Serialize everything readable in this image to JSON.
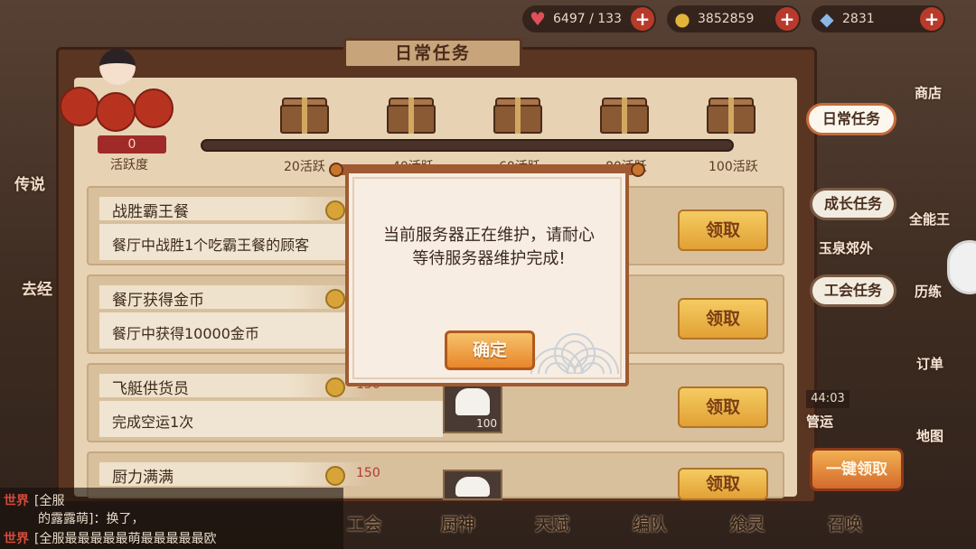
{
  "resources": [
    {
      "icon": "heart-icon",
      "glyph": "♥",
      "color": "#e0505a",
      "value": "6497 / 133"
    },
    {
      "icon": "gold-coin-icon",
      "glyph": "●",
      "color": "#e2b43a",
      "value": "3852859"
    },
    {
      "icon": "crystal-icon",
      "glyph": "◆",
      "color": "#8ab8e8",
      "value": "2831"
    }
  ],
  "panel": {
    "title": "日常任务"
  },
  "activity": {
    "value": "0",
    "label": "活跃度",
    "progress": 0,
    "milestones": [
      "20活跃",
      "40活跃",
      "60活跃",
      "80活跃",
      "100活跃"
    ]
  },
  "tasks": [
    {
      "name": "战胜霸王餐",
      "desc": "餐厅中战胜1个吃霸王餐的顾客",
      "reward": "",
      "item_qty": "",
      "claim": "领取"
    },
    {
      "name": "餐厅获得金币",
      "desc": "餐厅中获得10000金币",
      "reward": "",
      "item_qty": "",
      "claim": "领取"
    },
    {
      "name": "飞艇供货员",
      "desc": "完成空运1次",
      "reward": "150",
      "item_qty": "100",
      "claim": "领取"
    },
    {
      "name": "厨力满满",
      "desc": "",
      "reward": "150",
      "item_qty": "",
      "claim": "领取"
    }
  ],
  "side_tabs": [
    "日常任务",
    "成长任务",
    "工会任务"
  ],
  "side_misc": {
    "growth_sub": "玉泉郊外",
    "timer": "44:03",
    "claim_all": "一键领取"
  },
  "right_icons": [
    "商店",
    "全能王",
    "历练",
    "订单",
    "地图",
    "管运"
  ],
  "left_labels": [
    "传说",
    "去经"
  ],
  "bottom_nav": [
    "工会",
    "厨神",
    "天赋",
    "编队",
    "飨灵",
    "召唤"
  ],
  "chat": [
    {
      "tag": "世界",
      "text": "[全服"
    },
    {
      "tag": "",
      "text": "的露露萌]：换了，"
    },
    {
      "tag": "世界",
      "text": "[全服最最最最最萌最最最最最欧"
    }
  ],
  "modal": {
    "message": "当前服务器正在维护，请耐心等待服务器维护完成!",
    "confirm": "确定"
  }
}
